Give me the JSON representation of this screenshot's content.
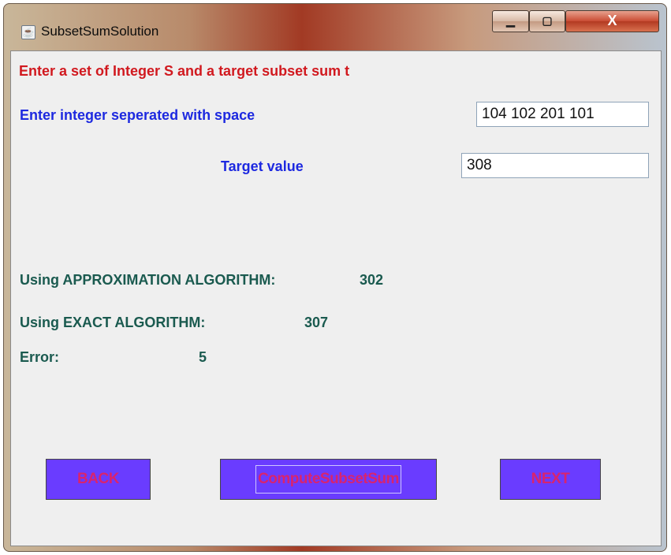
{
  "window": {
    "title": "SubsetSumSolution",
    "app_icon": "java-cup-icon",
    "controls": {
      "minimize": "▁",
      "maximize": "▢",
      "close": "X"
    }
  },
  "form": {
    "heading": "Enter a set of Integer S and a target subset sum t",
    "integers_label": "Enter integer seperated with space",
    "integers_value": "104 102 201 101",
    "target_label": "Target value",
    "target_value": "308"
  },
  "results": {
    "approx_label": "Using APPROXIMATION ALGORITHM:",
    "approx_value": "302",
    "exact_label": "Using EXACT ALGORITHM:",
    "exact_value": "307",
    "error_label": "Error:",
    "error_value": "5"
  },
  "buttons": {
    "back": "BACK",
    "compute": "ComputeSubsetSum",
    "next": "NEXT"
  },
  "colors": {
    "heading": "#d1191f",
    "input_labels": "#1d29e0",
    "result_labels": "#1a5a4f",
    "button_bg": "#6a3cff",
    "button_text": "#d8246e"
  }
}
